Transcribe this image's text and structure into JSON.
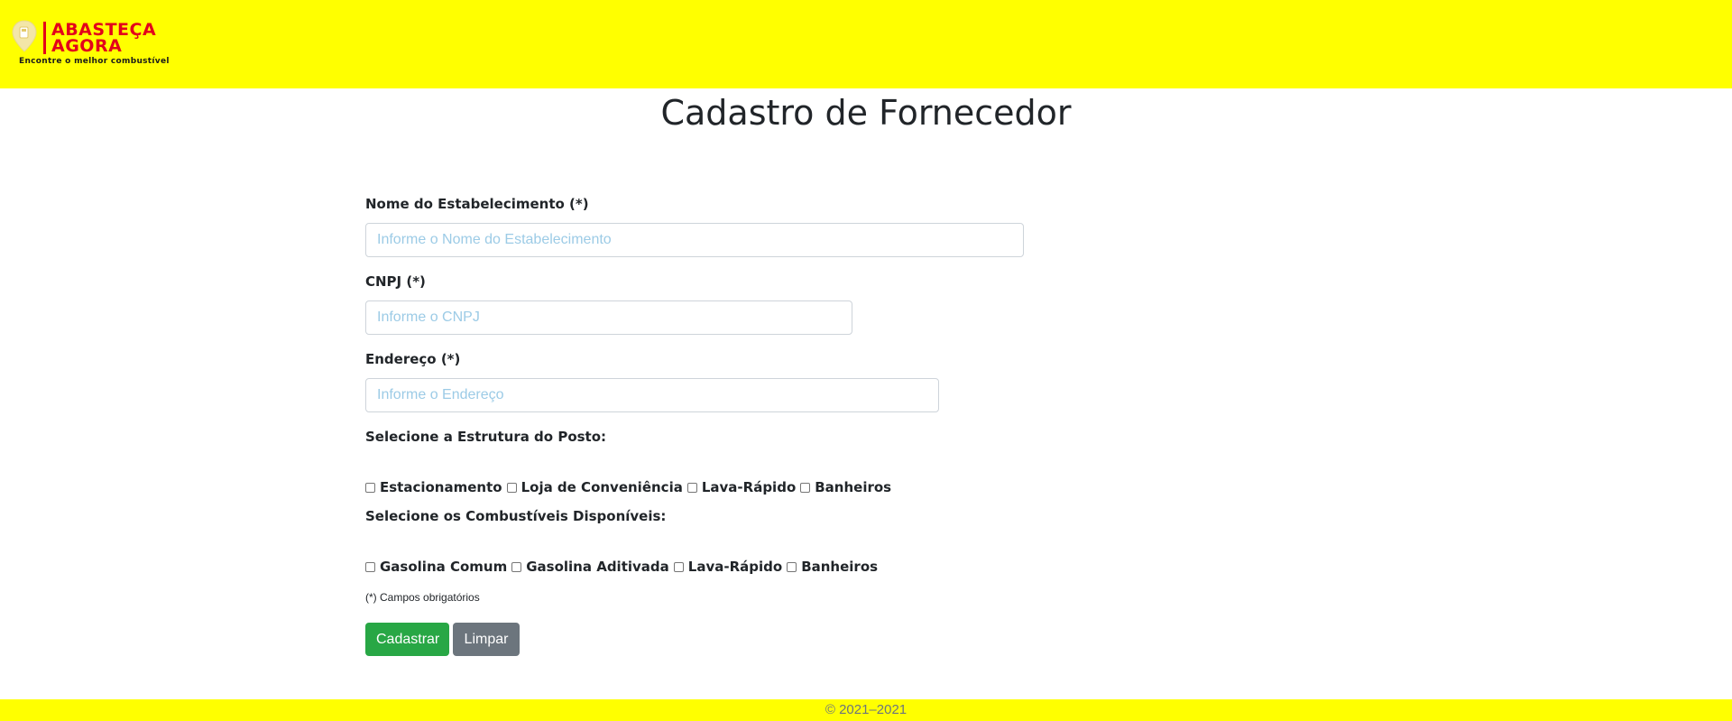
{
  "brand": {
    "line1": "ABASTEÇA",
    "line2": "AGORA",
    "tagline": "Encontre o melhor combustível",
    "header_color": "#ffff00",
    "brand_color": "#e3001b"
  },
  "page": {
    "title": "Cadastro de Fornecedor"
  },
  "form": {
    "name": {
      "label": "Nome do Estabelecimento (*)",
      "placeholder": "Informe o Nome do Estabelecimento",
      "value": ""
    },
    "cnpj": {
      "label": "CNPJ (*)",
      "placeholder": "Informe o CNPJ",
      "value": ""
    },
    "address": {
      "label": "Endereço (*)",
      "placeholder": "Informe o Endereço",
      "value": ""
    },
    "structure": {
      "label": "Selecione a Estrutura do Posto:",
      "options": [
        {
          "label": "Estacionamento",
          "checked": false
        },
        {
          "label": "Loja de Conveniência",
          "checked": false
        },
        {
          "label": "Lava-Rápido",
          "checked": false
        },
        {
          "label": "Banheiros",
          "checked": false
        }
      ]
    },
    "fuels": {
      "label": "Selecione os Combustíveis Disponíveis:",
      "options": [
        {
          "label": "Gasolina Comum",
          "checked": false
        },
        {
          "label": "Gasolina Aditivada",
          "checked": false
        },
        {
          "label": "Lava-Rápido",
          "checked": false
        },
        {
          "label": "Banheiros",
          "checked": false
        }
      ]
    },
    "required_note": "(*) Campos obrigatórios",
    "submit_label": "Cadastrar",
    "clear_label": "Limpar",
    "submit_color": "#28a745",
    "clear_color": "#6c757d"
  },
  "footer": {
    "text": "© 2021–2021"
  }
}
